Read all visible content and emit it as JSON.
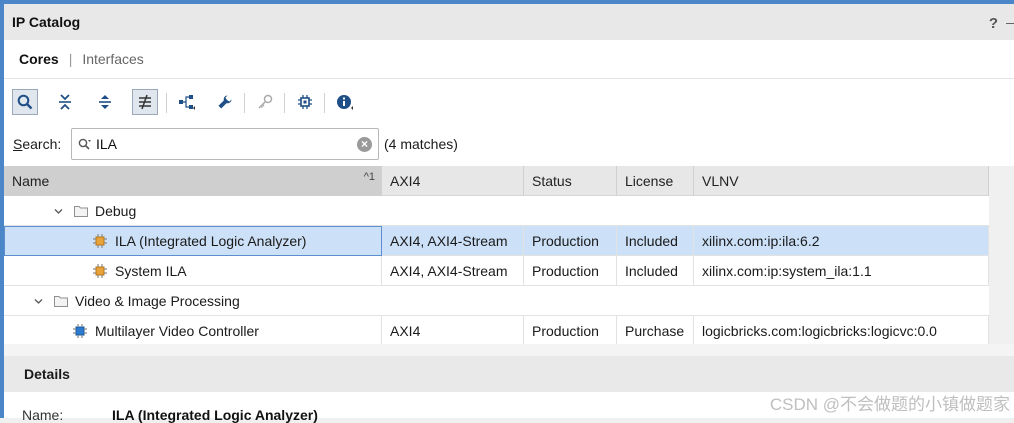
{
  "panel": {
    "title": "IP Catalog",
    "help": "?",
    "minimize": "_"
  },
  "tabs": [
    {
      "label": "Cores",
      "active": true
    },
    {
      "label": "Interfaces",
      "active": false
    }
  ],
  "toolbar": {
    "buttons": [
      "search-icon",
      "collapse-all-icon",
      "expand-all-icon",
      "group-by-icon",
      "hierarchy-icon",
      "wrench-icon",
      "key-icon",
      "chip-icon",
      "info-icon"
    ]
  },
  "search": {
    "label_prefix": "S",
    "label_rest": "earch:",
    "value": "ILA",
    "placeholder": "",
    "clear": "×",
    "matches": "(4 matches)"
  },
  "table": {
    "columns": {
      "name": "Name",
      "sort_indicator": "^1",
      "axi4": "AXI4",
      "status": "Status",
      "license": "License",
      "vlnv": "VLNV"
    },
    "rows": [
      {
        "type": "folder",
        "name": "Debug",
        "axi4": "",
        "status": "",
        "license": "",
        "vlnv": ""
      },
      {
        "type": "core",
        "name": "ILA (Integrated Logic Analyzer)",
        "axi4": "AXI4, AXI4-Stream",
        "status": "Production",
        "license": "Included",
        "vlnv": "xilinx.com:ip:ila:6.2",
        "selected": true
      },
      {
        "type": "core",
        "name": "System ILA",
        "axi4": "AXI4, AXI4-Stream",
        "status": "Production",
        "license": "Included",
        "vlnv": "xilinx.com:ip:system_ila:1.1"
      },
      {
        "type": "folder",
        "name": "Video & Image Processing",
        "axi4": "",
        "status": "",
        "license": "",
        "vlnv": ""
      },
      {
        "type": "core",
        "name": "Multilayer Video Controller",
        "axi4": "AXI4",
        "status": "Production",
        "license": "Purchase",
        "vlnv": "logicbricks.com:logicbricks:logicvc:0.0"
      }
    ]
  },
  "details": {
    "header": "Details",
    "name_key": "Name:",
    "name_value": "ILA (Integrated Logic Analyzer)"
  },
  "watermark": "CSDN @不会做题的小镇做题家",
  "colors": {
    "accent": "#4a86c8",
    "selection": "#cce0f7",
    "orange_chip": "#e8a33a",
    "blue_chip": "#2b7bd0"
  }
}
